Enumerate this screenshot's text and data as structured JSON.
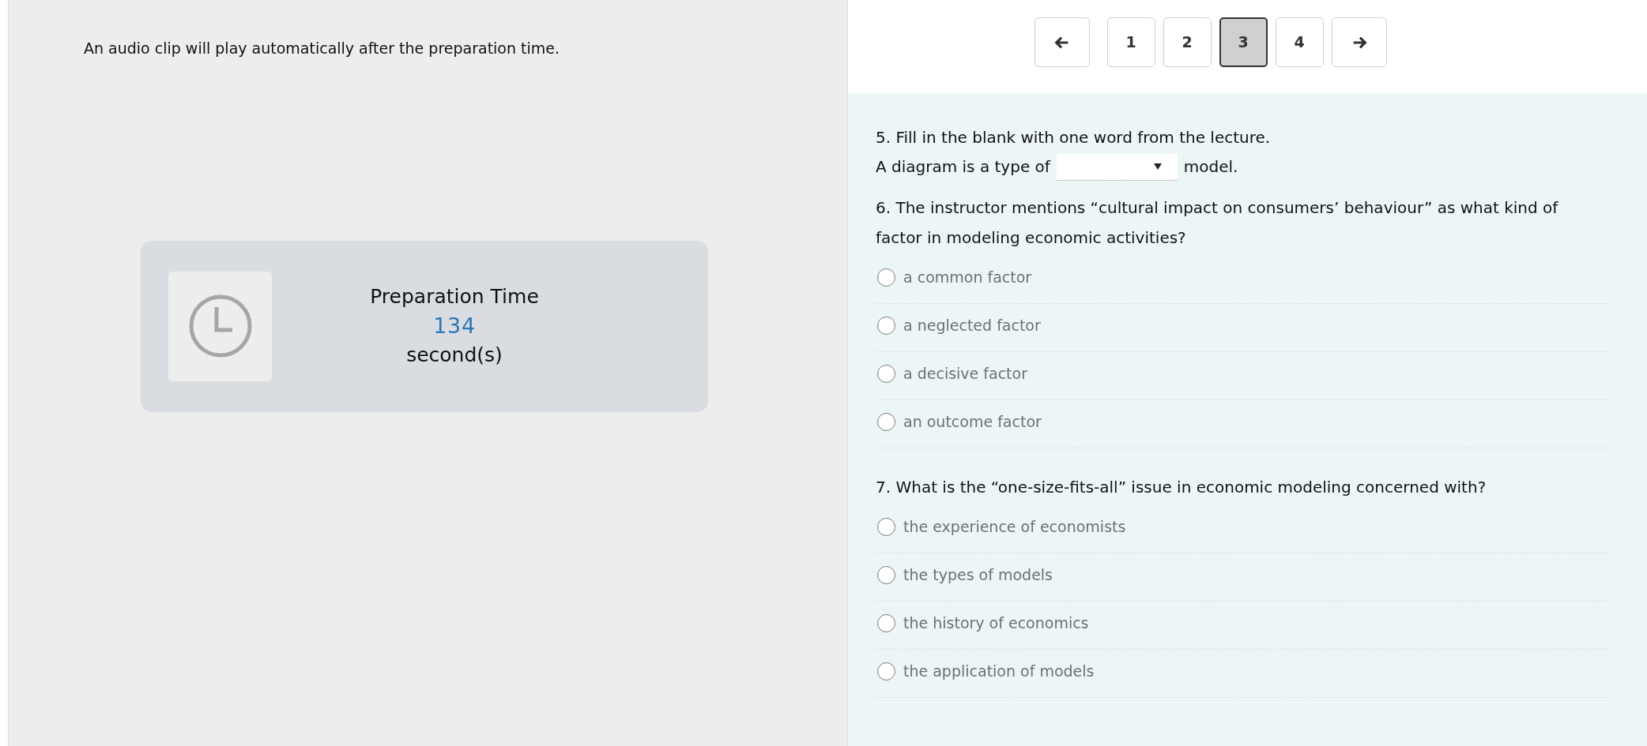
{
  "instruction": "An audio clip will play automatically after the preparation time.",
  "timer": {
    "title": "Preparation Time",
    "value": "134",
    "unit": "second(s)"
  },
  "pagination": {
    "pages": [
      {
        "label": "1",
        "selected": false
      },
      {
        "label": "2",
        "selected": false
      },
      {
        "label": "3",
        "selected": true
      },
      {
        "label": "4",
        "selected": false
      }
    ]
  },
  "questions": [
    {
      "kind": "fill",
      "prompt": "5. Fill in the blank with one word from the lecture.",
      "before": "A diagram is a type of",
      "after": "model."
    },
    {
      "kind": "choice",
      "prompt": "6. The instructor mentions “cultural impact on consumers’ behaviour” as what kind of factor in modeling economic activities?",
      "options": [
        {
          "label": "a common factor",
          "selected": false
        },
        {
          "label": "a neglected factor",
          "selected": false
        },
        {
          "label": "a decisive factor",
          "selected": false
        },
        {
          "label": "an outcome factor",
          "selected": false
        }
      ]
    },
    {
      "kind": "choice",
      "prompt": "7. What is the “one-size-fits-all” issue in economic modeling concerned with?",
      "options": [
        {
          "label": "the experience of economists",
          "selected": false
        },
        {
          "label": "the types of models",
          "selected": false
        },
        {
          "label": "the history of economics",
          "selected": false
        },
        {
          "label": "the application of models",
          "selected": false
        }
      ]
    }
  ]
}
